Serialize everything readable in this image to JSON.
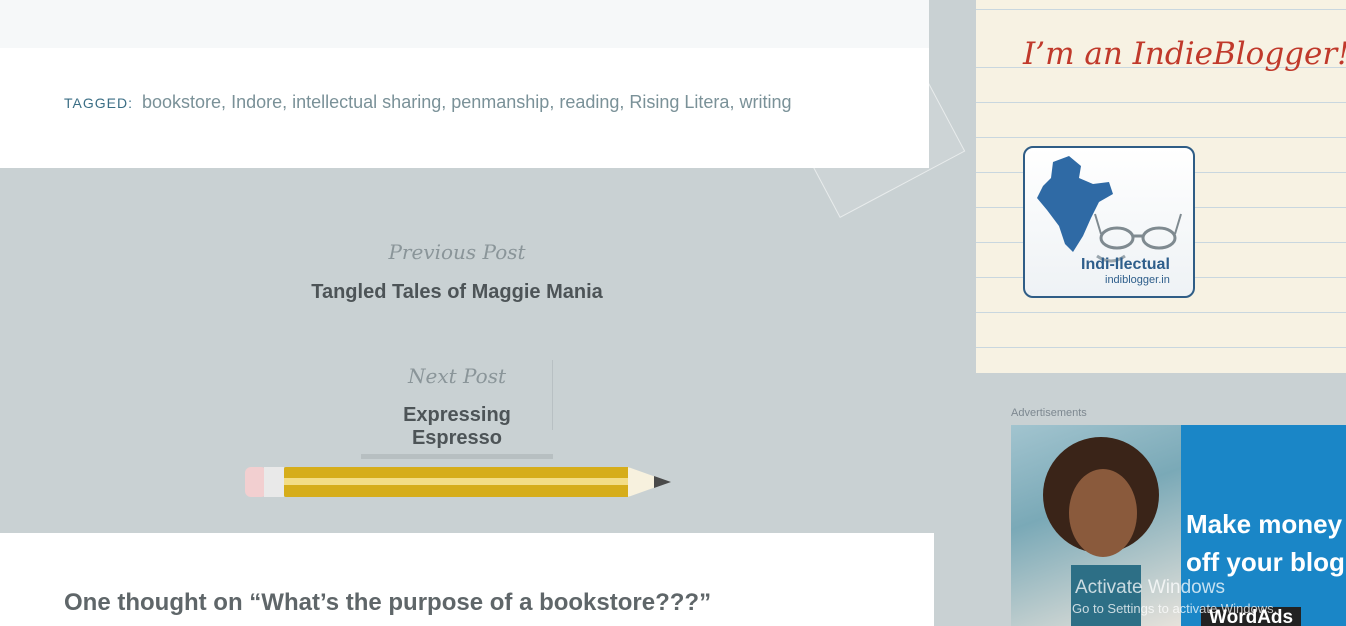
{
  "post_footer": {
    "tagged_label": "TAGGED:",
    "tags": [
      "bookstore",
      "Indore",
      "intellectual sharing",
      "penmanship",
      "reading",
      "Rising Litera",
      "writing"
    ]
  },
  "post_nav": {
    "previous_label": "Previous Post",
    "previous_title": "Tangled Tales of Maggie Mania",
    "next_label": "Next Post",
    "next_title": "Expressing Espresso"
  },
  "comments": {
    "heading": "One thought on “What’s the purpose of a bookstore???”"
  },
  "sidebar": {
    "indie_heading": "I’m an IndieBlogger!",
    "badge_title": "Indi-llectual",
    "badge_sub": "indiblogger.in",
    "ads_label": "Advertisements",
    "ad_headline_1": "Make money",
    "ad_headline_2": "off your blog",
    "ad_brand": "WordAds"
  },
  "overlay": {
    "windows_title": "Activate Windows",
    "windows_sub": "Go to Settings to activate Windows."
  },
  "colors": {
    "background": "#c9d1d3",
    "accent_tag": "#3b6e85",
    "indie_heading": "#c0392b",
    "ad_blue": "#1a86c7"
  }
}
